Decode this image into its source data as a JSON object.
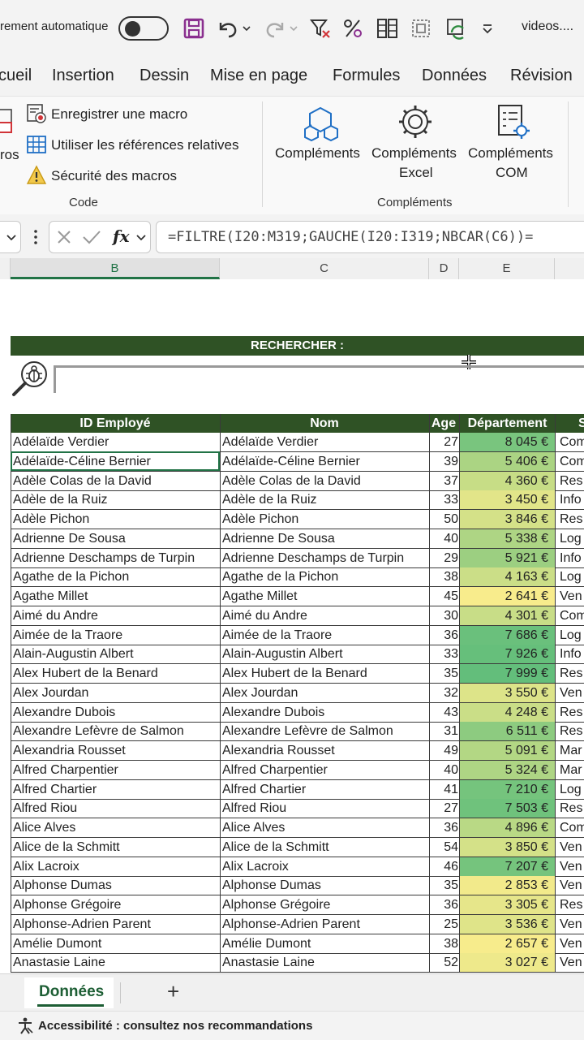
{
  "qat": {
    "autosave_label": "rement automatique",
    "doc_title": "videos...."
  },
  "tabs": [
    "cueil",
    "Insertion",
    "Dessin",
    "Mise en page",
    "Formules",
    "Données",
    "Révision"
  ],
  "ribbon": {
    "code": {
      "cut_label": "ros",
      "record_macro": "Enregistrer une macro",
      "relative_refs": "Utiliser les références relatives",
      "macro_security": "Sécurité des macros",
      "group_label": "Code"
    },
    "addins": {
      "addins": "Compléments",
      "excel_addins_line1": "Compléments",
      "excel_addins_line2": "Excel",
      "com_addins_line1": "Compléments",
      "com_addins_line2": "COM",
      "group_label": "Compléments"
    }
  },
  "formula_bar": {
    "fx": "fx",
    "formula": "=FILTRE(I20:M319;GAUCHE(I20:I319;NBCAR(C6))="
  },
  "columns": [
    "B",
    "C",
    "D",
    "E"
  ],
  "sheet": {
    "search_label": "RECHERCHER :",
    "headers": [
      "ID Employé",
      "Nom",
      "Age",
      "Département",
      "S"
    ],
    "rows": [
      {
        "id": "Adélaïde Verdier",
        "nom": "Adélaïde Verdier",
        "age": "27",
        "dept": "8 045 €",
        "s": "Com",
        "shade": 0.85
      },
      {
        "id": "Adélaïde-Céline Bernier",
        "nom": "Adélaïde-Céline Bernier",
        "age": "39",
        "dept": "5 406 €",
        "s": "Com",
        "shade": 0.52
      },
      {
        "id": "Adèle Colas de la David",
        "nom": "Adèle Colas de la David",
        "age": "37",
        "dept": "4 360 €",
        "s": "Res",
        "shade": 0.33
      },
      {
        "id": "Adèle de la Ruiz",
        "nom": "Adèle de la Ruiz",
        "age": "33",
        "dept": "3 450 €",
        "s": "Info",
        "shade": 0.15
      },
      {
        "id": "Adèle Pichon",
        "nom": "Adèle Pichon",
        "age": "50",
        "dept": "3 846 €",
        "s": "Res",
        "shade": 0.24
      },
      {
        "id": "Adrienne De Sousa",
        "nom": "Adrienne De Sousa",
        "age": "40",
        "dept": "5 338 €",
        "s": "Log",
        "shade": 0.5
      },
      {
        "id": "Adrienne Deschamps de Turpin",
        "nom": "Adrienne Deschamps de Turpin",
        "age": "29",
        "dept": "5 921 €",
        "s": "Info",
        "shade": 0.62
      },
      {
        "id": "Agathe de la Pichon",
        "nom": "Agathe de la Pichon",
        "age": "38",
        "dept": "4 163 €",
        "s": "Log",
        "shade": 0.3
      },
      {
        "id": "Agathe Millet",
        "nom": "Agathe Millet",
        "age": "45",
        "dept": "2 641 €",
        "s": "Ven",
        "shade": 0.0
      },
      {
        "id": "Aimé du Andre",
        "nom": "Aimé du Andre",
        "age": "30",
        "dept": "4 301 €",
        "s": "Com",
        "shade": 0.32
      },
      {
        "id": "Aimée de la Traore",
        "nom": "Aimée de la Traore",
        "age": "36",
        "dept": "7 686 €",
        "s": "Log",
        "shade": 0.95
      },
      {
        "id": "Alain-Augustin Albert",
        "nom": "Alain-Augustin Albert",
        "age": "33",
        "dept": "7 926 €",
        "s": "Info",
        "shade": 0.98
      },
      {
        "id": "Alex Hubert de la Benard",
        "nom": "Alex Hubert de la Benard",
        "age": "35",
        "dept": "7 999 €",
        "s": "Res",
        "shade": 1.0
      },
      {
        "id": "Alex Jourdan",
        "nom": "Alex Jourdan",
        "age": "32",
        "dept": "3 550 €",
        "s": "Ven",
        "shade": 0.18
      },
      {
        "id": "Alexandre Dubois",
        "nom": "Alexandre Dubois",
        "age": "43",
        "dept": "4 248 €",
        "s": "Res",
        "shade": 0.31
      },
      {
        "id": "Alexandre Lefèvre de Salmon",
        "nom": "Alexandre Lefèvre de Salmon",
        "age": "31",
        "dept": "6 511 €",
        "s": "Res",
        "shade": 0.72
      },
      {
        "id": "Alexandria Rousset",
        "nom": "Alexandria Rousset",
        "age": "49",
        "dept": "5 091 €",
        "s": "Mar",
        "shade": 0.46
      },
      {
        "id": "Alfred Charpentier",
        "nom": "Alfred Charpentier",
        "age": "40",
        "dept": "5 324 €",
        "s": "Mar",
        "shade": 0.5
      },
      {
        "id": "Alfred Chartier",
        "nom": "Alfred Chartier",
        "age": "41",
        "dept": "7 210 €",
        "s": "Log",
        "shade": 0.88
      },
      {
        "id": "Alfred Riou",
        "nom": "Alfred Riou",
        "age": "27",
        "dept": "7 503 €",
        "s": "Res",
        "shade": 0.92
      },
      {
        "id": "Alice Alves",
        "nom": "Alice Alves",
        "age": "36",
        "dept": "4 896 €",
        "s": "Com",
        "shade": 0.42
      },
      {
        "id": "Alice de la Schmitt",
        "nom": "Alice de la Schmitt",
        "age": "54",
        "dept": "3 850 €",
        "s": "Ven",
        "shade": 0.24
      },
      {
        "id": "Alix Lacroix",
        "nom": "Alix Lacroix",
        "age": "46",
        "dept": "7 207 €",
        "s": "Ven",
        "shade": 0.88
      },
      {
        "id": "Alphonse Dumas",
        "nom": "Alphonse Dumas",
        "age": "35",
        "dept": "2 853 €",
        "s": "Ven",
        "shade": 0.04
      },
      {
        "id": "Alphonse Grégoire",
        "nom": "Alphonse Grégoire",
        "age": "36",
        "dept": "3 305 €",
        "s": "Res",
        "shade": 0.12
      },
      {
        "id": "Alphonse-Adrien Parent",
        "nom": "Alphonse-Adrien Parent",
        "age": "25",
        "dept": "3 536 €",
        "s": "Ven",
        "shade": 0.17
      },
      {
        "id": "Amélie Dumont",
        "nom": "Amélie Dumont",
        "age": "38",
        "dept": "2 657 €",
        "s": "Ven",
        "shade": 0.01
      },
      {
        "id": "Anastasie Laine",
        "nom": "Anastasie Laine",
        "age": "52",
        "dept": "3 027 €",
        "s": "Ven",
        "shade": 0.07
      }
    ]
  },
  "sheet_tabs": {
    "active": "Données",
    "add": "+"
  },
  "status": {
    "accessibility": "Accessibilité : consultez nos recommandations"
  },
  "colors": {
    "header_green": "#2f5225",
    "scale_low": "#f8ec8c",
    "scale_high": "#63be7b",
    "save_purple": "#8a2f8f",
    "accent_blue": "#1f6fc5"
  }
}
